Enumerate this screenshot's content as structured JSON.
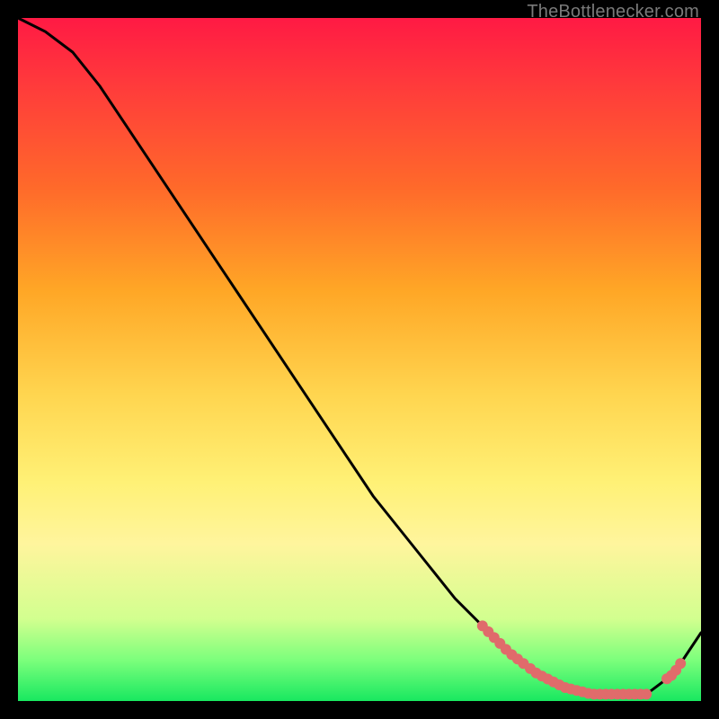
{
  "attribution": "TheBottlenecker.com",
  "chart_data": {
    "type": "line",
    "title": "",
    "xlabel": "",
    "ylabel": "",
    "xlim": [
      0,
      100
    ],
    "ylim": [
      0,
      100
    ],
    "series": [
      {
        "name": "curve",
        "x": [
          0,
          4,
          8,
          12,
          16,
          20,
          24,
          28,
          32,
          36,
          40,
          44,
          48,
          52,
          56,
          60,
          64,
          68,
          72,
          76,
          80,
          84,
          88,
          92,
          96,
          100
        ],
        "y": [
          100,
          98,
          95,
          90,
          84,
          78,
          72,
          66,
          60,
          54,
          48,
          42,
          36,
          30,
          25,
          20,
          15,
          11,
          7,
          4,
          2,
          1,
          1,
          1,
          4,
          10
        ]
      }
    ],
    "highlight_ranges": [
      {
        "x_start": 68,
        "x_end": 74
      },
      {
        "x_start": 75,
        "x_end": 92
      },
      {
        "x_start": 95,
        "x_end": 97
      }
    ],
    "colors": {
      "curve": "#000000",
      "highlight": "#e06b6b",
      "gradient_top": "#ff1a44",
      "gradient_bottom": "#18e860"
    }
  }
}
